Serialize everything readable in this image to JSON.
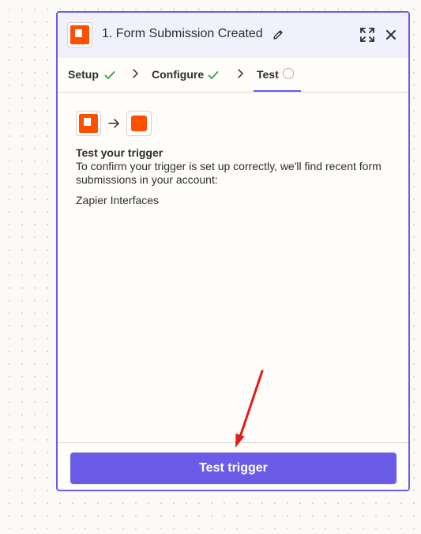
{
  "panel": {
    "title": "1. Form Submission Created",
    "app_icon": "zapier-interfaces-icon",
    "actions": {
      "edit_icon": "pencil-icon",
      "expand_icon": "expand-icon",
      "close_icon": "close-icon"
    }
  },
  "tabs": [
    {
      "label": "Setup",
      "status": "complete"
    },
    {
      "label": "Configure",
      "status": "complete"
    },
    {
      "label": "Test",
      "status": "pending",
      "active": true
    }
  ],
  "content": {
    "section_title": "Test your trigger",
    "section_description": "To confirm your trigger is set up correctly, we'll find recent form submissions in your account:",
    "account_name": "Zapier Interfaces"
  },
  "footer": {
    "button_label": "Test trigger"
  },
  "colors": {
    "accent": "#6b5ce7",
    "brand_orange": "#ff4f00",
    "success_green": "#2e9e4a",
    "annotation_red": "#e41b1b"
  }
}
